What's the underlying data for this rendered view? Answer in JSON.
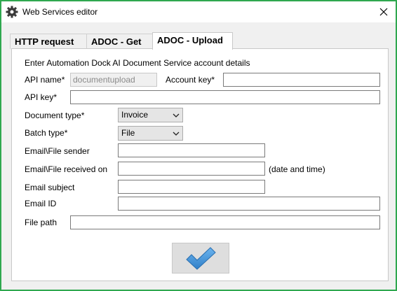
{
  "window": {
    "title": "Web Services editor",
    "app_icon": "gear-icon",
    "close_icon": "close-icon",
    "border_color": "#2fa84f"
  },
  "tabs": [
    {
      "label": "HTTP request",
      "active": false
    },
    {
      "label": "ADOC - Get",
      "active": false
    },
    {
      "label": "ADOC - Upload",
      "active": true
    }
  ],
  "form": {
    "heading": "Enter Automation Dock AI Document Service account details",
    "api_name_label": "API name*",
    "api_name_value": "documentupload",
    "account_key_label": "Account key*",
    "account_key_value": "",
    "api_key_label": "API key*",
    "api_key_value": "",
    "document_type_label": "Document type*",
    "document_type_value": "Invoice",
    "batch_type_label": "Batch type*",
    "batch_type_value": "File",
    "email_file_sender_label": "Email\\File sender",
    "email_file_received_label": "Email\\File received on",
    "date_hint": "(date and time)",
    "email_subject_label": "Email subject",
    "email_id_label": "Email ID",
    "file_path_label": "File path"
  },
  "ok_button": {
    "icon": "checkmark-icon",
    "icon_color": "#3d8fd6"
  }
}
